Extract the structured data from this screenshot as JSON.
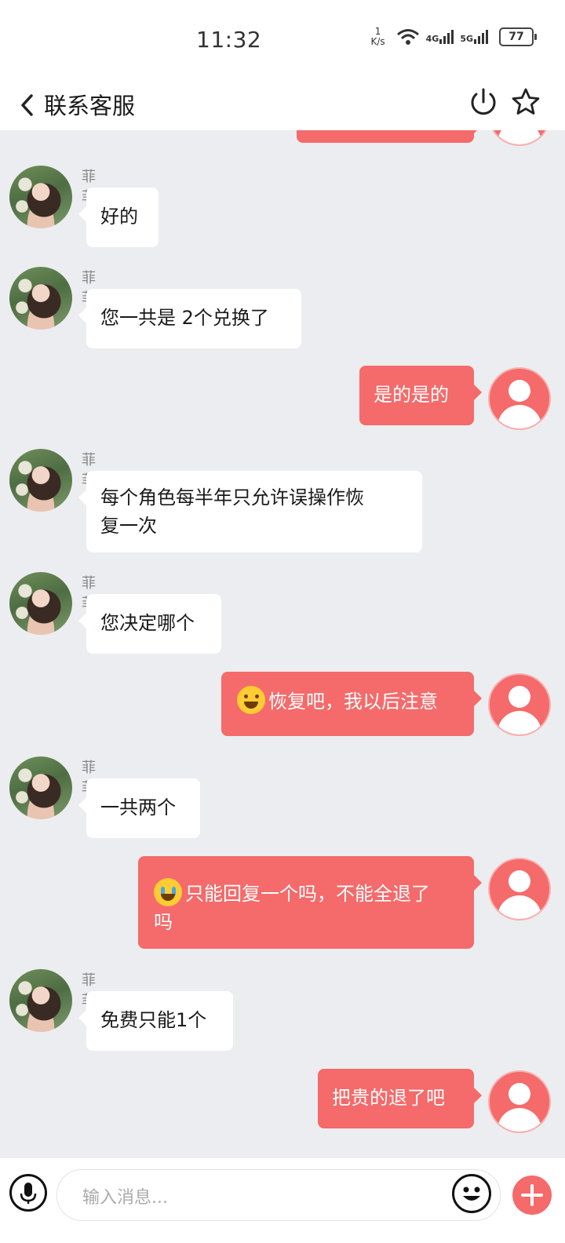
{
  "status_bar": {
    "time": "11:32",
    "net_speed_value": "1",
    "net_speed_unit": "K/s",
    "sig1_label": "4G",
    "sig2_label": "5G",
    "battery": "77"
  },
  "header": {
    "title": "联系客服"
  },
  "colors": {
    "accent": "#f56a6a",
    "background": "#ecedf0",
    "bubble_in": "#ffffff"
  },
  "messages": [
    {
      "side": "out",
      "text": ""
    },
    {
      "side": "in",
      "sender": "菲菲",
      "text": "好的"
    },
    {
      "side": "in",
      "sender": "菲菲",
      "text": "您一共是 2个兑换了"
    },
    {
      "side": "out",
      "text": "是的是的"
    },
    {
      "side": "in",
      "sender": "菲菲",
      "text_line1": "每个角色每半年只允许误操作恢",
      "text_line2": "复一次"
    },
    {
      "side": "in",
      "sender": "菲菲",
      "text": "您决定哪个"
    },
    {
      "side": "out",
      "emoji": "rofl-emoji",
      "text": "恢复吧，我以后注意"
    },
    {
      "side": "in",
      "sender": "菲菲",
      "text": "一共两个"
    },
    {
      "side": "out",
      "emoji": "crying-emoji",
      "text_line1": "只能回复一个吗，不能全退了",
      "text_line2": "吗"
    },
    {
      "side": "in",
      "sender": "菲菲",
      "text": "免费只能1个"
    },
    {
      "side": "out",
      "text": "把贵的退了吧"
    }
  ],
  "input": {
    "placeholder": "输入消息..."
  }
}
